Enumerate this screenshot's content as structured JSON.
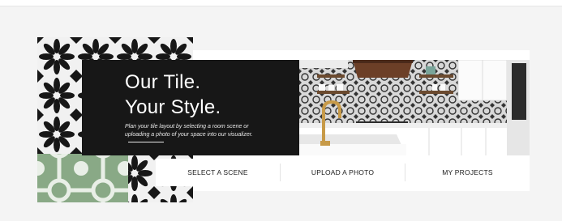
{
  "hero": {
    "headline_line1": "Our Tile.",
    "headline_line2": "Your Style.",
    "subtext": "Plan your tile layout by selecting a room scene or uploading a photo of your space into our visualizer."
  },
  "actions": [
    {
      "label": "SELECT A SCENE"
    },
    {
      "label": "UPLOAD A PHOTO"
    },
    {
      "label": "MY PROJECTS"
    }
  ],
  "colors": {
    "page_background": "#f4f4f4",
    "hero_panel": "#171717",
    "tile_black": "#171717",
    "tile_green": "#89a986"
  }
}
